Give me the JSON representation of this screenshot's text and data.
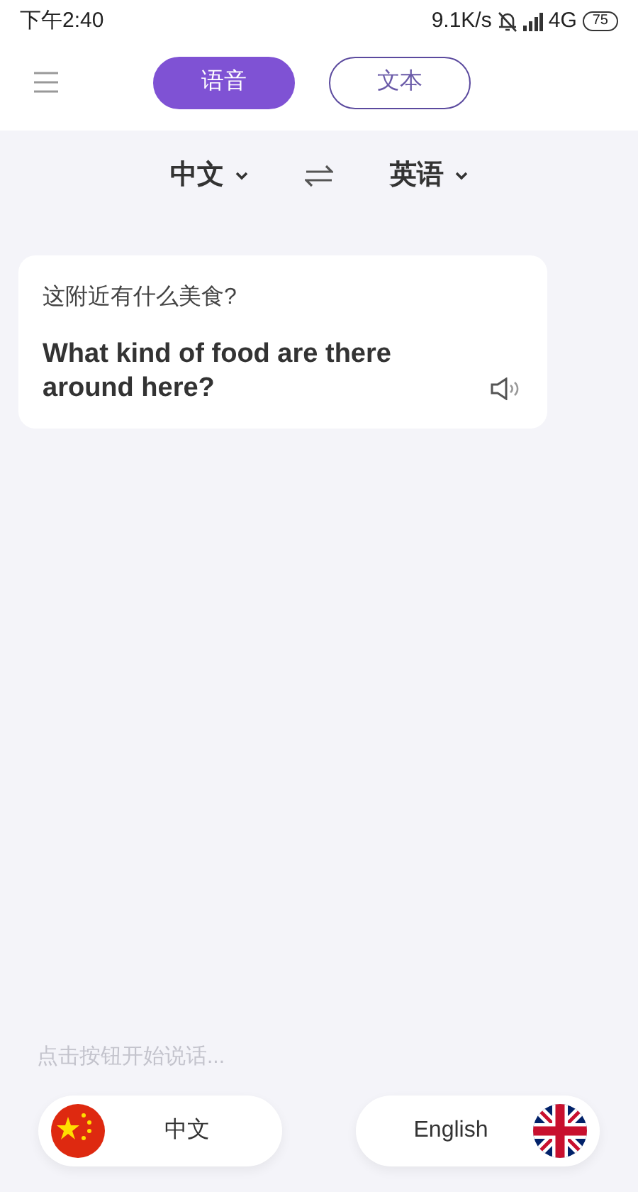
{
  "status_bar": {
    "time": "下午2:40",
    "speed": "9.1K/s",
    "network": "4G",
    "battery": "75"
  },
  "tabs": [
    {
      "label": "语音",
      "selected": true
    },
    {
      "label": "文本",
      "selected": false
    }
  ],
  "languages": {
    "source": "中文",
    "target": "英语"
  },
  "result": {
    "source_text": "这附近有什么美食?",
    "translation": "What kind of food are there around here?"
  },
  "hint": "点击按钮开始说话...",
  "speak_buttons": [
    {
      "label": "中文"
    },
    {
      "label": "English"
    }
  ]
}
